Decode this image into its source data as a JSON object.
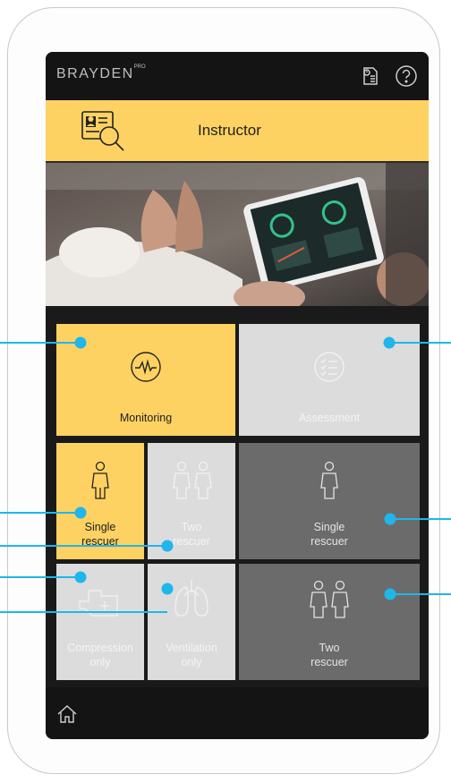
{
  "app": {
    "logo_text": "BRAYDEN",
    "logo_badge": "PRO"
  },
  "topbar": {
    "icons": [
      "manual-icon",
      "help-icon"
    ]
  },
  "banner": {
    "title": "Instructor",
    "icon": "user-search-icon"
  },
  "tiles": {
    "monitoring": {
      "label": "Monitoring",
      "icon": "heartbeat-icon",
      "state": "selected"
    },
    "assessment": {
      "label": "Assessment",
      "icon": "checklist-icon",
      "state": "disabled"
    },
    "single_rescuer_left": {
      "label": "Single\nrescuer",
      "icon": "person-icon",
      "state": "selected"
    },
    "two_rescuer_left": {
      "label": "Two\nrescuer",
      "icon": "two-people-icon",
      "state": "disabled"
    },
    "compression_only": {
      "label": "Compression\nonly",
      "icon": "compression-icon",
      "state": "disabled"
    },
    "ventilation_only": {
      "label": "Ventilation\nonly",
      "icon": "lungs-icon",
      "state": "disabled"
    },
    "single_rescuer_right": {
      "label": "Single\nrescuer",
      "icon": "person-icon",
      "state": "dark"
    },
    "two_rescuer_right": {
      "label": "Two\nrescuer",
      "icon": "two-people-icon",
      "state": "dark"
    }
  },
  "bottombar": {
    "icon": "home-icon"
  },
  "colors": {
    "accent_yellow": "#fdd262",
    "callout_blue": "#1fb6ec",
    "screen_bg": "#141414",
    "tile_light": "#dcdcdc",
    "tile_dark": "#6b6b6b"
  }
}
